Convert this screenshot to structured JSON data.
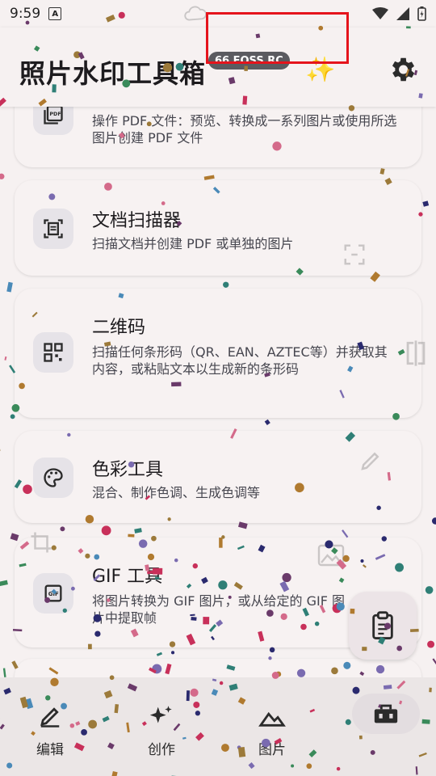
{
  "status_bar": {
    "time": "9:59",
    "a_badge": "A"
  },
  "header": {
    "title": "照片水印工具箱",
    "version_badge": "66 FOSS RC",
    "sparkle_icon": "✨"
  },
  "tools": [
    {
      "icon": "pdf-icon",
      "title": "",
      "description": "操作 PDF 文件：预览、转换成一系列图片或使用所选图片创建 PDF 文件"
    },
    {
      "icon": "document-scanner-icon",
      "title": "文档扫描器",
      "description": "扫描文档并创建 PDF 或单独的图片"
    },
    {
      "icon": "qr-code-icon",
      "title": "二维码",
      "description": "扫描任何条形码（QR、EAN、AZTEC等）并获取其内容，或粘贴文本以生成新的条形码"
    },
    {
      "icon": "palette-icon",
      "title": "色彩工具",
      "description": "混合、制作色调、生成色调等"
    },
    {
      "icon": "gif-icon",
      "title": "GIF 工具",
      "description": "将图片转换为 GIF 图片，或从给定的 GIF 图片中提取帧"
    }
  ],
  "bottom_nav": {
    "items": [
      {
        "label": "编辑",
        "icon": "edit-icon"
      },
      {
        "label": "创作",
        "icon": "create-sparkle-icon"
      },
      {
        "label": "图片",
        "icon": "image-icon"
      }
    ]
  },
  "fab": {
    "icon": "clipboard-icon"
  },
  "fab_small": {
    "icon": "toolbox-icon"
  },
  "colors": {
    "highlight": "#e5141c",
    "badge": "#5b5b60",
    "background": "#f6f1f1"
  }
}
